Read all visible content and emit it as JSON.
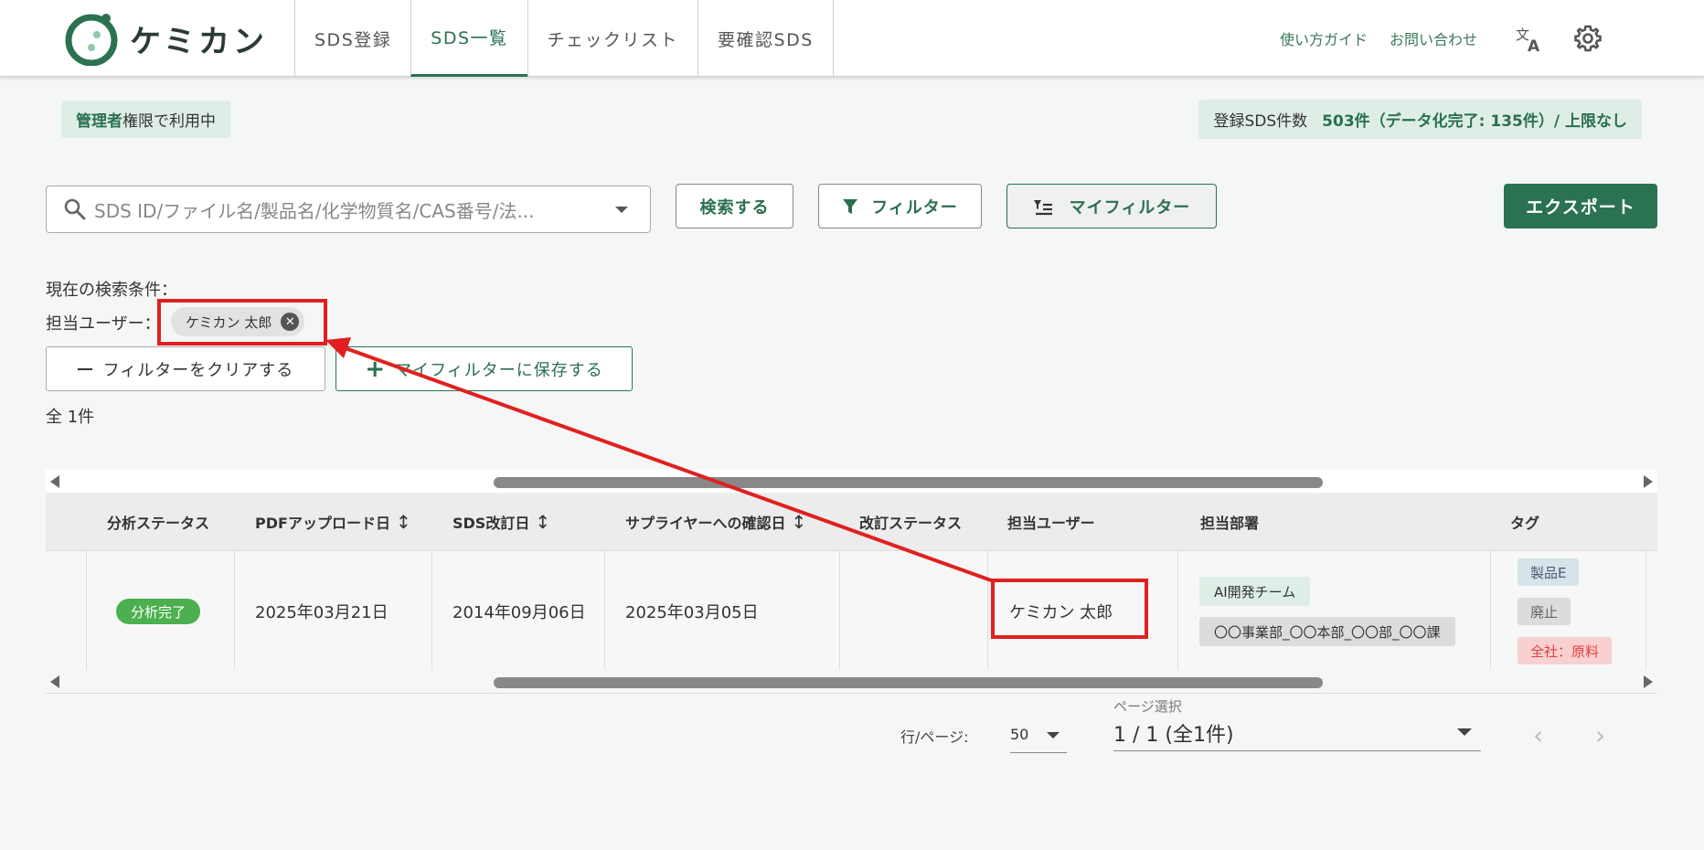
{
  "app": {
    "name": "ケミカン",
    "accent": "#2a7251"
  },
  "nav": {
    "tabs": [
      {
        "label": "SDS登録"
      },
      {
        "label": "SDS一覧"
      },
      {
        "label": "チェックリスト"
      },
      {
        "label": "要確認SDS"
      }
    ],
    "active_index": 1
  },
  "header": {
    "guide_link": "使い方ガイド",
    "contact_link": "お問い合わせ",
    "icons": [
      "translate-icon",
      "gear-icon"
    ]
  },
  "status": {
    "admin_strong": "管理者",
    "admin_rest": "権限で利用中",
    "count_label": "登録SDS件数",
    "count_value": "503件（データ化完了: 135件）/ 上限なし"
  },
  "search": {
    "placeholder": "SDS ID/ファイル名/製品名/化学物質名/CAS番号/法...",
    "search_button": "検索する",
    "filter_button": "フィルター",
    "myfilter_button": "マイフィルター",
    "export_button": "エクスポート"
  },
  "conditions": {
    "label": "現在の検索条件：",
    "user_label": "担当ユーザー：",
    "user_chip": "ケミカン 太郎",
    "clear_button": "フィルターをクリアする",
    "save_button": "マイフィルターに保存する"
  },
  "total": "全 1件",
  "table": {
    "columns": [
      "分析ステータス",
      "PDFアップロード日",
      "SDS改訂日",
      "サプライヤーへの確認日",
      "改訂ステータス",
      "担当ユーザー",
      "担当部署",
      "タグ"
    ],
    "rows": [
      {
        "status": "分析完了",
        "pdf_upload_date": "2025年03月21日",
        "sds_revision_date": "2014年09月06日",
        "supplier_confirm_date": "2025年03月05日",
        "revision_status": "",
        "user": "ケミカン 太郎",
        "departments": [
          "AI開発チーム",
          "〇〇事業部_〇〇本部_〇〇部_〇〇課"
        ],
        "tags": [
          "製品E",
          "廃止",
          "全社：原料"
        ]
      }
    ]
  },
  "pagination": {
    "rows_label": "行/ページ:",
    "rows_value": "50",
    "page_label": "ページ選択",
    "page_value": "1 / 1 (全1件)"
  },
  "colors": {
    "status_green": "#4caf50",
    "dept_green": "#deeee6",
    "tag_blue": "#d5e4e8",
    "tag_gray": "#dcdcdc",
    "tag_red": "#f9d0d0",
    "annotation_red": "#e02020"
  }
}
